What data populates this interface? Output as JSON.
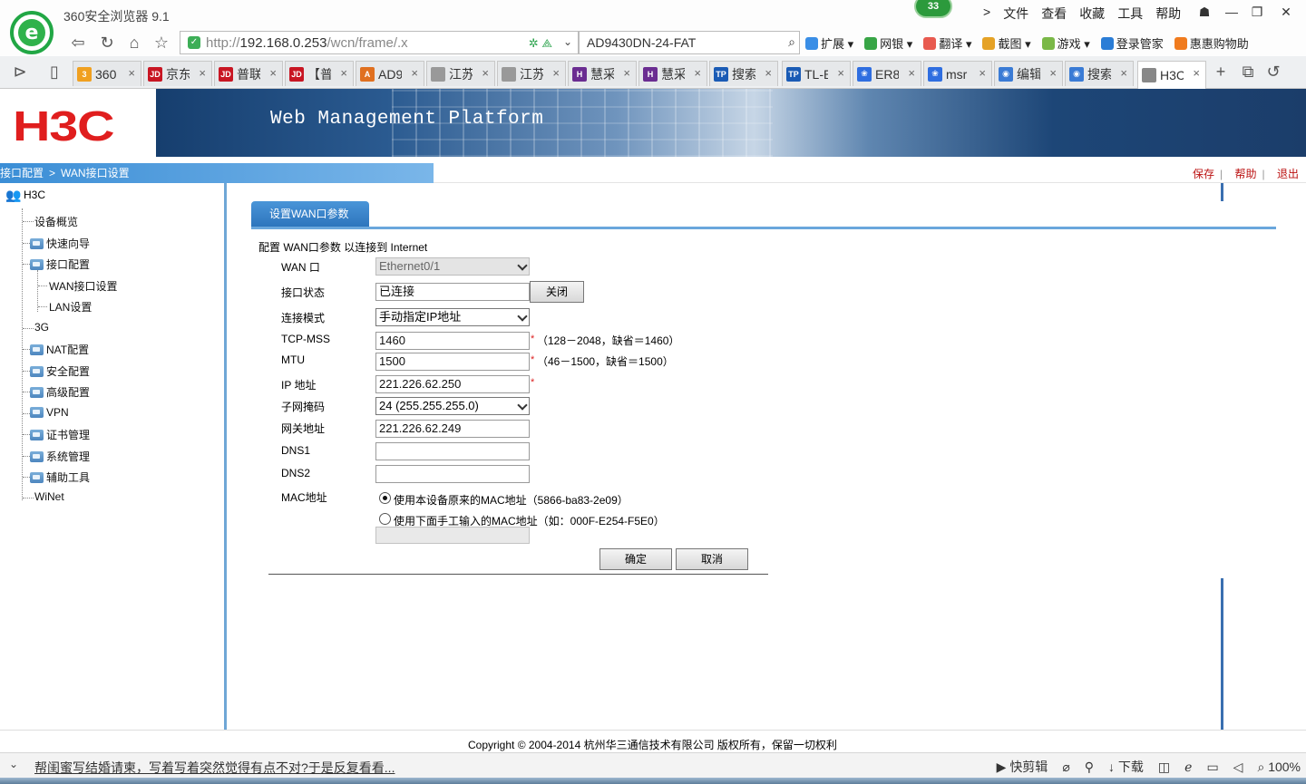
{
  "browser": {
    "app_title": "360安全浏览器 9.1",
    "notify_count": "33",
    "menu": [
      "文件",
      "查看",
      "收藏",
      "工具",
      "帮助"
    ],
    "menu_chevron": ">",
    "url_prefix": "http://",
    "url_host": "192.168.0.253",
    "url_path": "/wcn/frame/.x",
    "search_text": "AD9430DN-24-FAT",
    "toolbar": [
      "扩展",
      "网银",
      "翻译",
      "截图",
      "游戏",
      "登录管家",
      "惠惠购物助"
    ],
    "tabs": [
      {
        "label": "360",
        "icon_color": "#f0a020",
        "icon_text": "3"
      },
      {
        "label": "京东",
        "icon_color": "#c81623",
        "icon_text": "JD"
      },
      {
        "label": "普联",
        "icon_color": "#c81623",
        "icon_text": "JD"
      },
      {
        "label": "【普",
        "icon_color": "#c81623",
        "icon_text": "JD"
      },
      {
        "label": "AD9",
        "icon_color": "#e07020",
        "icon_text": "A"
      },
      {
        "label": "江苏",
        "icon_color": "#999999",
        "icon_text": ""
      },
      {
        "label": "江苏",
        "icon_color": "#999999",
        "icon_text": ""
      },
      {
        "label": "慧采",
        "icon_color": "#6a2c91",
        "icon_text": "H"
      },
      {
        "label": "慧采",
        "icon_color": "#6a2c91",
        "icon_text": "H"
      },
      {
        "label": "搜索",
        "icon_color": "#1a5bb5",
        "icon_text": "TP"
      },
      {
        "label": "TL-E",
        "icon_color": "#1a5bb5",
        "icon_text": "TP"
      },
      {
        "label": "ER8",
        "icon_color": "#2f6ee0",
        "icon_text": "❀"
      },
      {
        "label": "msr",
        "icon_color": "#2f6ee0",
        "icon_text": "❀"
      },
      {
        "label": "编辑",
        "icon_color": "#3a7bd5",
        "icon_text": "◉"
      },
      {
        "label": "搜索",
        "icon_color": "#3a7bd5",
        "icon_text": "◉"
      },
      {
        "label": "H3C",
        "icon_color": "#888888",
        "icon_text": ""
      }
    ],
    "new_tab": "+",
    "status_text": "帮闺蜜写结婚请柬，写着写着突然觉得有点不对?于是反复看看...",
    "status_right": [
      "快剪辑",
      "下载",
      "100%"
    ]
  },
  "header": {
    "logo": "H3C",
    "platform_title": "Web Management Platform"
  },
  "breadcrumb": {
    "parent": "接口配置",
    "separator": ">",
    "current": "WAN接口设置"
  },
  "top_links": [
    "保存",
    "帮助",
    "退出"
  ],
  "sidebar": {
    "root": "H3C",
    "items": [
      {
        "label": "设备概览",
        "folder": false
      },
      {
        "label": "快速向导",
        "folder": true
      },
      {
        "label": "接口配置",
        "folder": true
      },
      {
        "label": "WAN接口设置",
        "folder": false,
        "child": true
      },
      {
        "label": "LAN设置",
        "folder": false,
        "child": true
      },
      {
        "label": "3G",
        "folder": false
      },
      {
        "label": "NAT配置",
        "folder": true
      },
      {
        "label": "安全配置",
        "folder": true
      },
      {
        "label": "高级配置",
        "folder": true
      },
      {
        "label": "VPN",
        "folder": true
      },
      {
        "label": "证书管理",
        "folder": true
      },
      {
        "label": "系统管理",
        "folder": true
      },
      {
        "label": "辅助工具",
        "folder": true
      },
      {
        "label": "WiNet",
        "folder": false
      }
    ]
  },
  "form": {
    "tab_title": "设置WAN口参数",
    "intro": "配置 WAN口参数 以连接到 Internet",
    "wan_port_label": "WAN 口",
    "wan_port_value": "Ethernet0/1",
    "status_label": "接口状态",
    "status_value": "已连接",
    "close_button": "关闭",
    "mode_label": "连接模式",
    "mode_value": "手动指定IP地址",
    "mss_label": "TCP-MSS",
    "mss_value": "1460",
    "mss_hint": "（128－2048，缺省＝1460）",
    "mtu_label": "MTU",
    "mtu_value": "1500",
    "mtu_hint": "（46－1500，缺省＝1500）",
    "ip_label": "IP 地址",
    "ip_value": "221.226.62.250",
    "mask_label": "子网掩码",
    "mask_value": "24 (255.255.255.0)",
    "gw_label": "网关地址",
    "gw_value": "221.226.62.249",
    "dns1_label": "DNS1",
    "dns1_value": "",
    "dns2_label": "DNS2",
    "dns2_value": "",
    "mac_label": "MAC地址",
    "mac_option1": "使用本设备原来的MAC地址（5866-ba83-2e09）",
    "mac_option2": "使用下面手工输入的MAC地址（如：000F-E254-F5E0）",
    "mac_selected": 1,
    "required_mark": "*",
    "ok_button": "确定",
    "cancel_button": "取消"
  },
  "footer": {
    "copyright": "Copyright © 2004-2014 杭州华三通信技术有限公司 版权所有，保留一切权利"
  }
}
